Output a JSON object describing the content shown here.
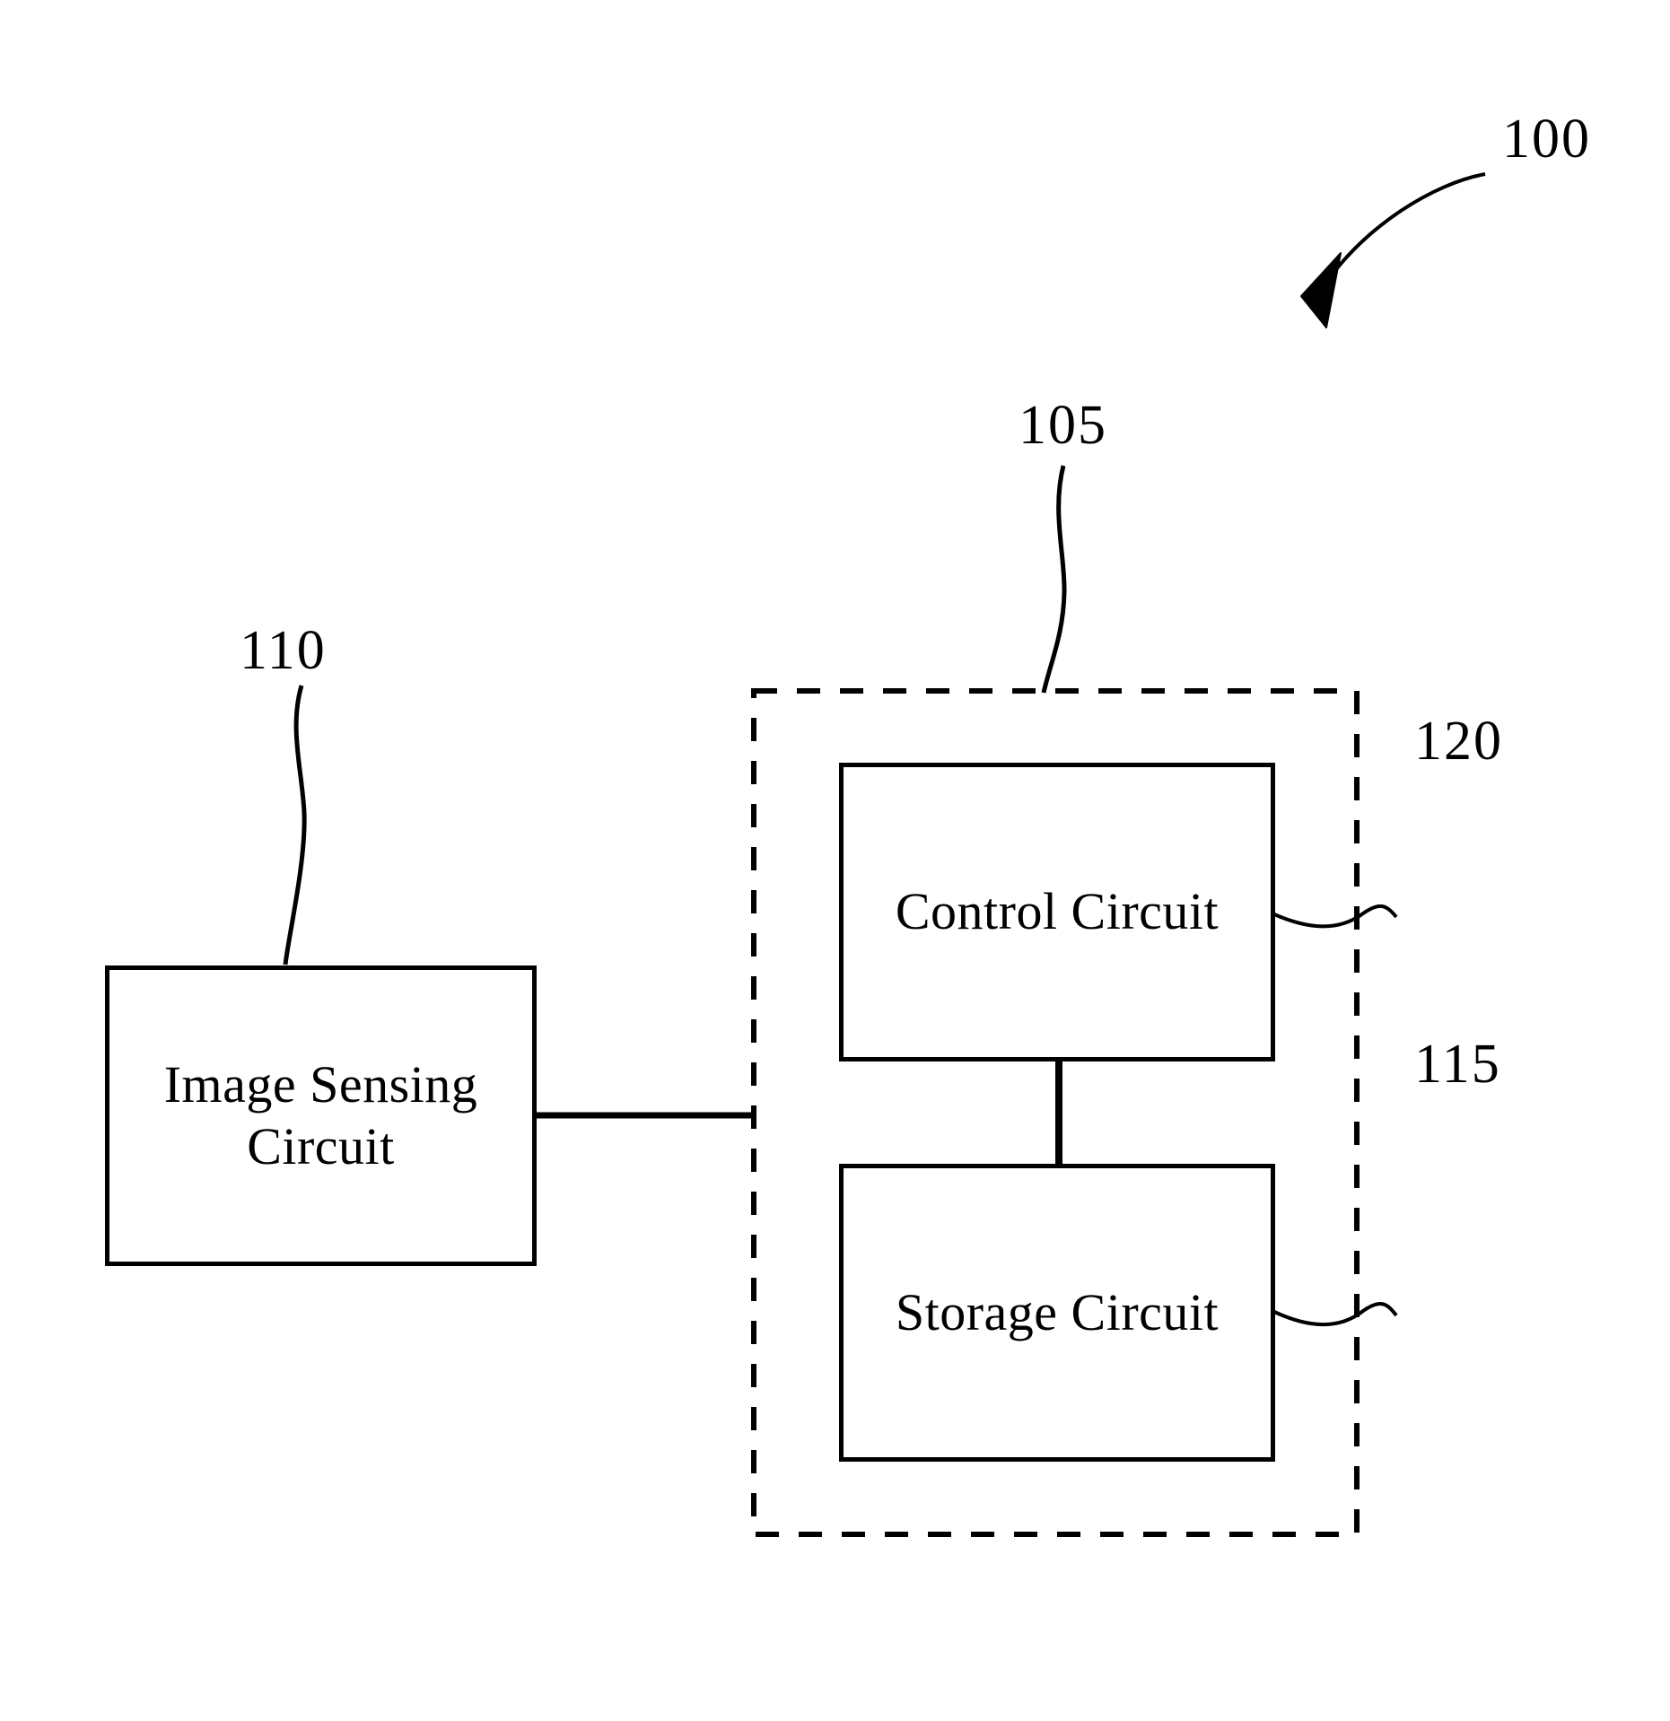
{
  "figure": {
    "background_color": "#ffffff",
    "stroke_color": "#000000",
    "nodes": [
      {
        "id": "image-sensing-circuit",
        "label": "Image Sensing\nCircuit",
        "ref": "110"
      },
      {
        "id": "control-circuit",
        "label": "Control Circuit",
        "ref": "120"
      },
      {
        "id": "storage-circuit",
        "label": "Storage Circuit",
        "ref": "115"
      }
    ],
    "groups": [
      {
        "id": "processing-module",
        "ref": "105",
        "style": "dashed",
        "contains": [
          "control-circuit",
          "storage-circuit"
        ]
      }
    ],
    "system": {
      "id": "system",
      "ref": "100",
      "pointer": "curved-arrow"
    },
    "reference_numerals": {
      "system": "100",
      "module": "105",
      "image_sensing": "110",
      "storage": "115",
      "control": "120"
    },
    "connections": [
      {
        "from": "image-sensing-circuit",
        "to": "processing-module",
        "style": "solid"
      },
      {
        "from": "control-circuit",
        "to": "storage-circuit",
        "style": "solid"
      }
    ]
  }
}
